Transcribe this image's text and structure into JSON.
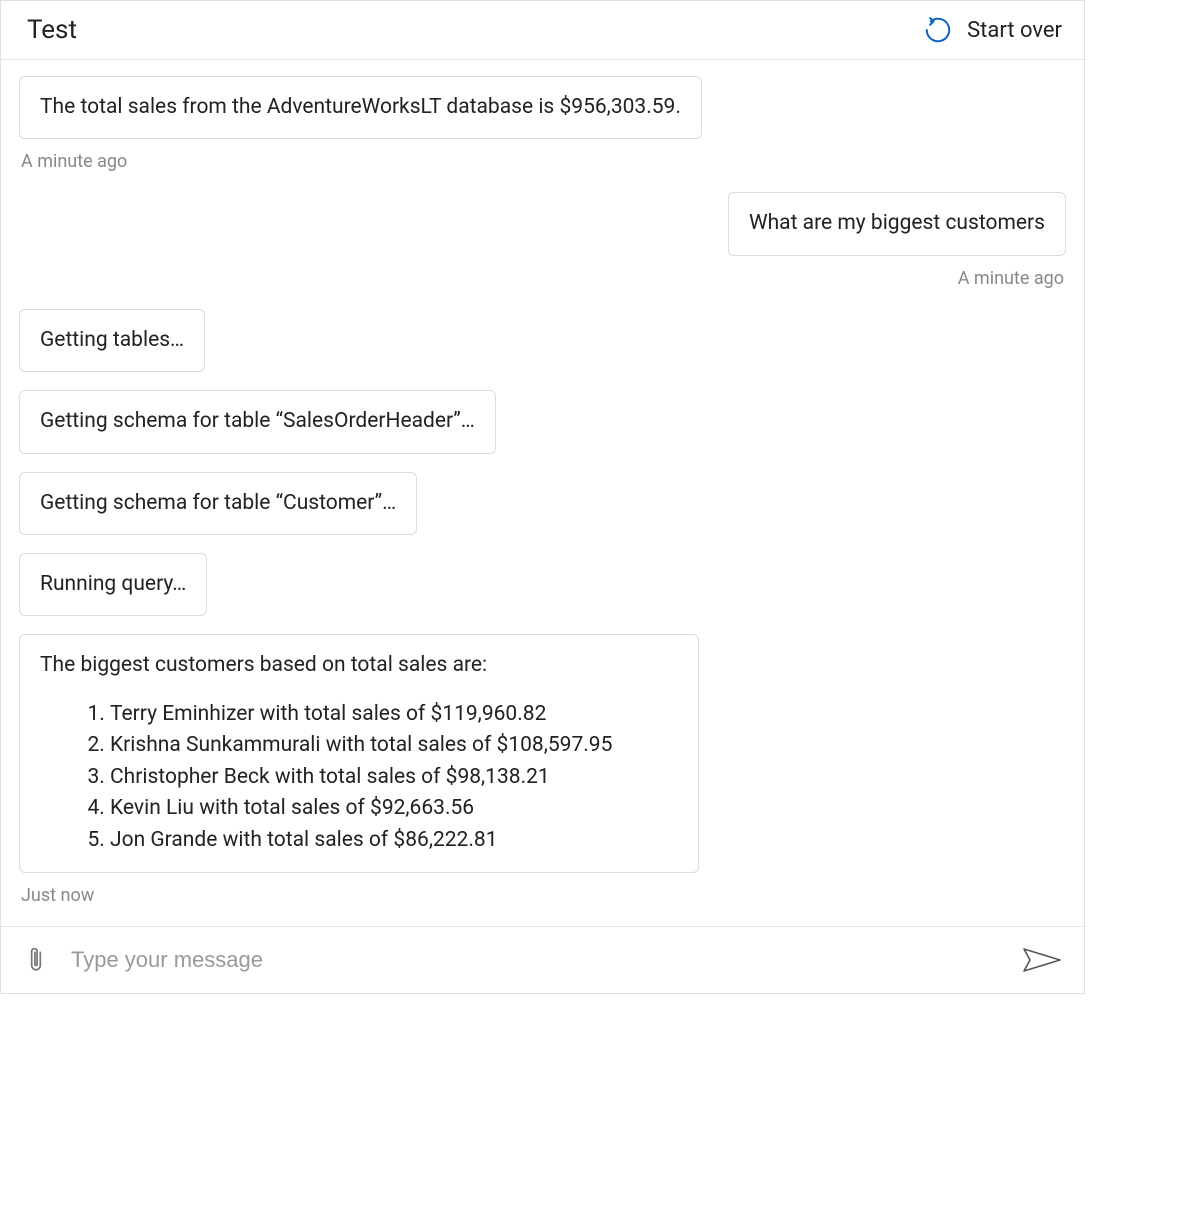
{
  "header": {
    "title": "Test",
    "start_over_label": "Start over"
  },
  "messages": {
    "group1": {
      "bubble1": "The total sales from the AdventureWorksLT database is $956,303.59.",
      "timestamp": "A minute ago"
    },
    "group2": {
      "bubble1": "What are my biggest customers",
      "timestamp": "A minute ago"
    },
    "group3": {
      "status1": "Getting tables…",
      "status2": "Getting schema for table “SalesOrderHeader”…",
      "status3": "Getting schema for table “Customer”…",
      "status4": "Running query…",
      "result_intro": "The biggest customers based on total sales are:",
      "result_items": {
        "0": "Terry Eminhizer with total sales of $119,960.82",
        "1": "Krishna Sunkammurali with total sales of $108,597.95",
        "2": "Christopher Beck with total sales of $98,138.21",
        "3": "Kevin Liu with total sales of $92,663.56",
        "4": "Jon Grande with total sales of $86,222.81"
      },
      "timestamp": "Just now"
    }
  },
  "input": {
    "placeholder": "Type your message"
  },
  "colors": {
    "accent_blue": "#0a64c2"
  }
}
